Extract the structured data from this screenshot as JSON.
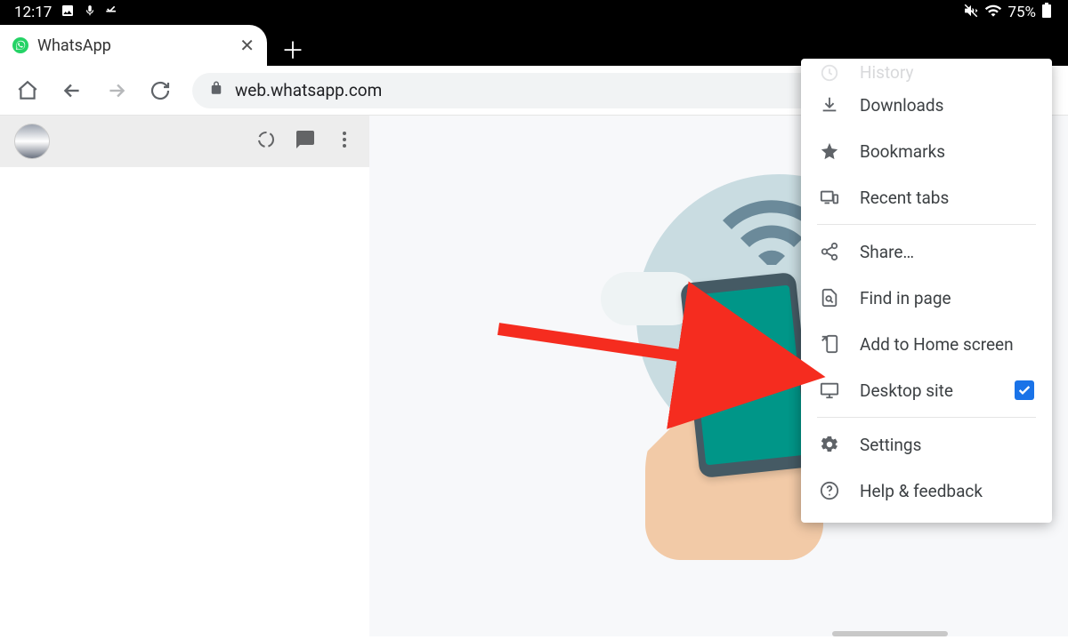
{
  "statusbar": {
    "time": "12:17",
    "battery": "75%"
  },
  "tab": {
    "title": "WhatsApp"
  },
  "toolbar": {
    "url": "web.whatsapp.com"
  },
  "menu": {
    "history": "History",
    "downloads": "Downloads",
    "bookmarks": "Bookmarks",
    "recent_tabs": "Recent tabs",
    "share": "Share…",
    "find_in_page": "Find in page",
    "add_to_home": "Add to Home screen",
    "desktop_site": "Desktop site",
    "settings": "Settings",
    "help": "Help & feedback",
    "desktop_site_checked": true
  }
}
